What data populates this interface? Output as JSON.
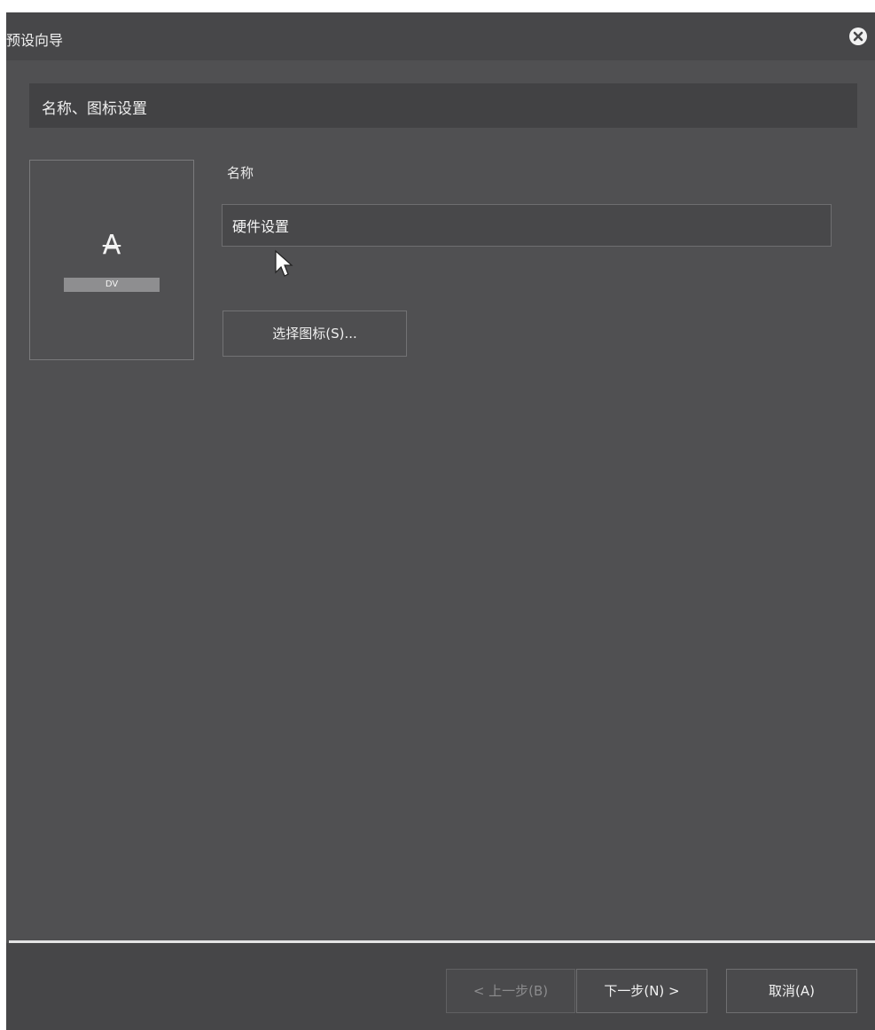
{
  "window": {
    "title": "预设向导",
    "close_icon": "close-circle-icon"
  },
  "section": {
    "header": "名称、图标设置"
  },
  "icon_preview": {
    "letter": "A",
    "badge": "DV"
  },
  "name_field": {
    "label": "名称",
    "value": "硬件设置"
  },
  "select_icon_button": {
    "label": "选择图标(S)..."
  },
  "footer": {
    "back_label": "< 上一步(B)",
    "next_label": "下一步(N) >",
    "cancel_label": "取消(A)"
  },
  "colors": {
    "dialog_bg": "#505052",
    "titlebar_bg": "#474749",
    "divider": "#e4e4e4"
  }
}
